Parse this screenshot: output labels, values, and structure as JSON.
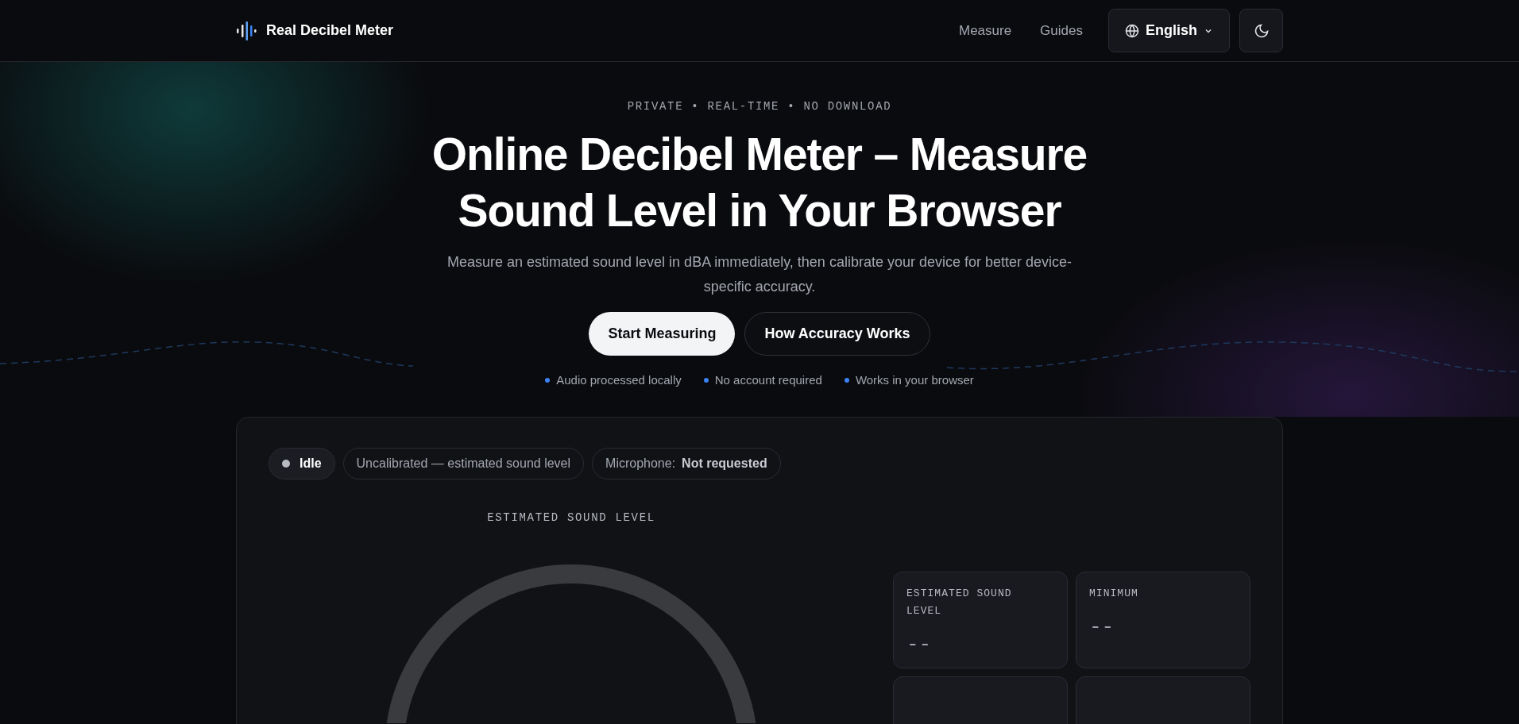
{
  "brand": {
    "name": "Real Decibel Meter"
  },
  "nav": {
    "links": [
      "Measure",
      "Guides"
    ],
    "language": "English"
  },
  "hero": {
    "eyebrow": "PRIVATE • REAL-TIME • NO DOWNLOAD",
    "title_lines": [
      "Online Decibel Meter – Measure",
      "Sound Level in Your Browser"
    ],
    "subtitle": "Measure an estimated sound level in dBA immediately, then calibrate your device for better device-specific accuracy.",
    "buttons": [
      {
        "label": "Start Measuring",
        "kind": "primary"
      },
      {
        "label": "How Accuracy Works",
        "kind": "secondary"
      }
    ],
    "features": [
      "Audio processed locally",
      "No account required",
      "Works in your browser"
    ]
  },
  "meter": {
    "status": "Idle",
    "calibration": "Uncalibrated — estimated sound level",
    "microphone_label": "Microphone:",
    "microphone_value": "Not requested",
    "gauge_label": "ESTIMATED SOUND LEVEL",
    "stats": [
      {
        "label": "ESTIMATED SOUND LEVEL",
        "value": "--"
      },
      {
        "label": "MINIMUM",
        "value": "--"
      }
    ]
  }
}
